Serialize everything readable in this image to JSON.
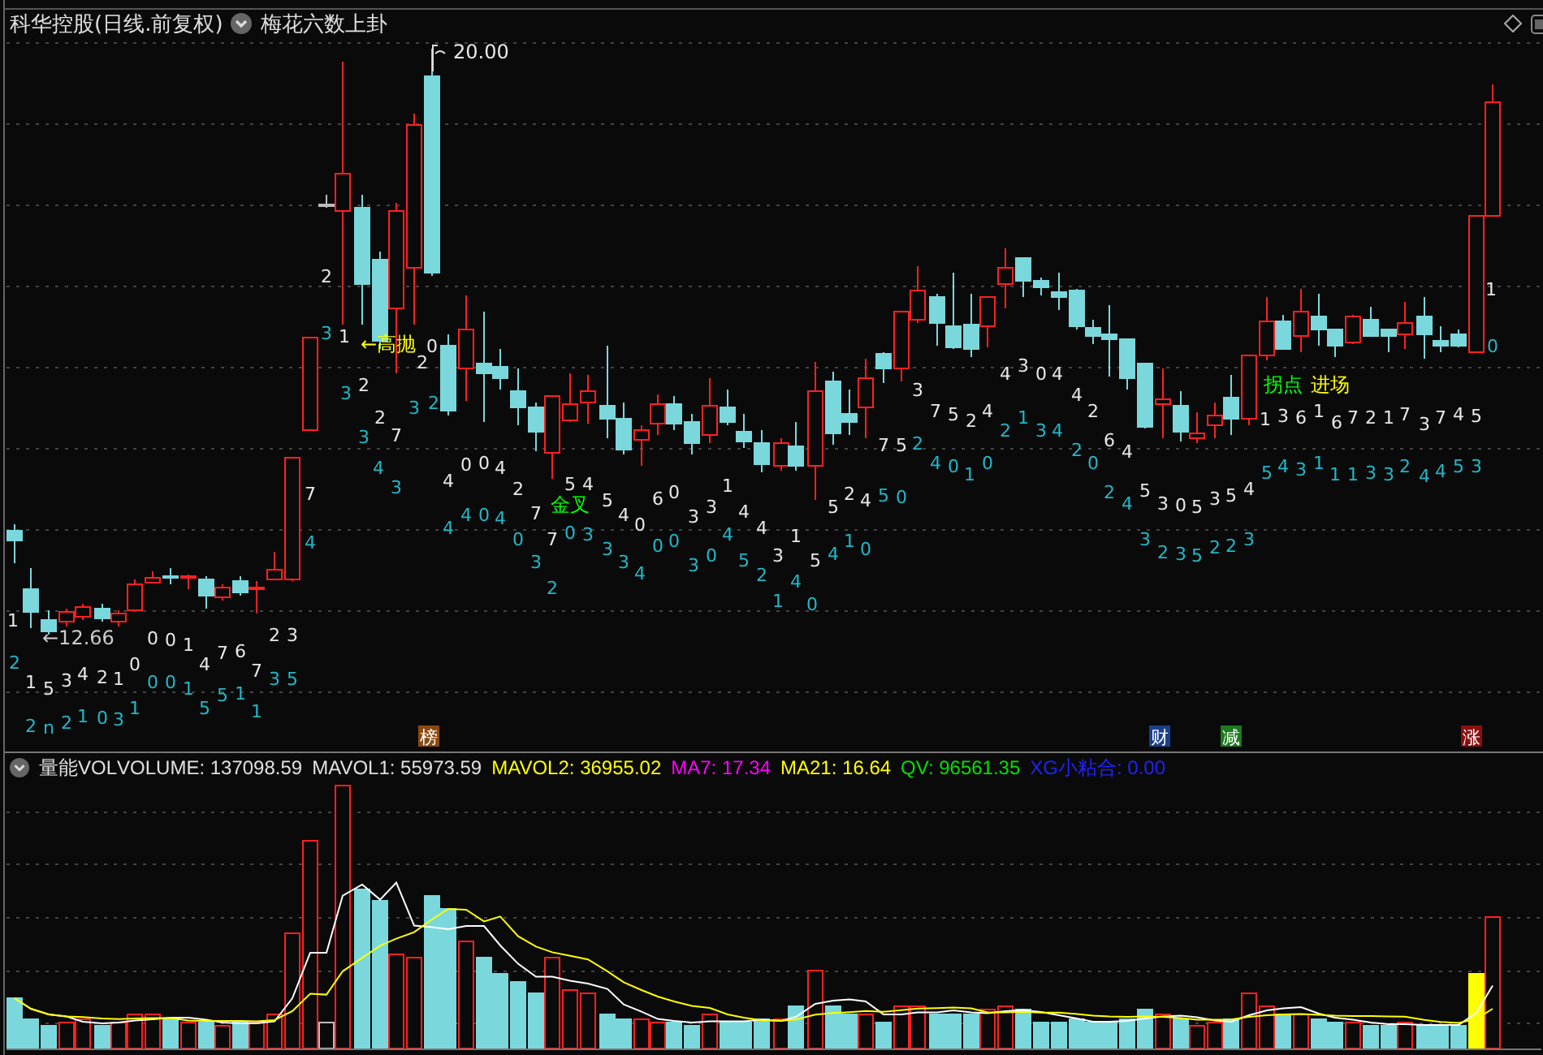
{
  "header": {
    "title": "科华控股(日线.前复权)",
    "indicator": "梅花六数上卦"
  },
  "price_marks": [
    {
      "kind": "high",
      "text": "20.00"
    },
    {
      "kind": "low",
      "text": "←12.66"
    }
  ],
  "signals": [
    {
      "text": "←高抛",
      "color": "#ffff00"
    },
    {
      "text": "金叉",
      "color": "#00ff00"
    },
    {
      "text": "拐点",
      "color": "#00ff00"
    },
    {
      "text": "进场",
      "color": "#ffff00"
    }
  ],
  "digits": [
    {
      "text": "1",
      "color": "#e8e8e8"
    },
    {
      "text": "2",
      "color": "#20b8c8"
    },
    {
      "text": "1",
      "color": "#e8e8e8"
    },
    {
      "text": "5",
      "color": "#e8e8e8"
    },
    {
      "text": "3",
      "color": "#e8e8e8"
    },
    {
      "text": "4",
      "color": "#e8e8e8"
    },
    {
      "text": "2",
      "color": "#e8e8e8"
    },
    {
      "text": "1",
      "color": "#e8e8e8"
    },
    {
      "text": "2",
      "color": "#20b8c8"
    },
    {
      "text": "n",
      "color": "#20b8c8"
    },
    {
      "text": "2",
      "color": "#20b8c8"
    },
    {
      "text": "1",
      "color": "#20b8c8"
    },
    {
      "text": "0",
      "color": "#20b8c8"
    },
    {
      "text": "3",
      "color": "#20b8c8"
    },
    {
      "text": "0",
      "color": "#e8e8e8"
    },
    {
      "text": "1",
      "color": "#20b8c8"
    },
    {
      "text": "0",
      "color": "#e8e8e8"
    },
    {
      "text": "0",
      "color": "#e8e8e8"
    },
    {
      "text": "1",
      "color": "#e8e8e8"
    },
    {
      "text": "0",
      "color": "#20b8c8"
    },
    {
      "text": "0",
      "color": "#20b8c8"
    },
    {
      "text": "1",
      "color": "#20b8c8"
    },
    {
      "text": "4",
      "color": "#e8e8e8"
    },
    {
      "text": "7",
      "color": "#e8e8e8"
    },
    {
      "text": "6",
      "color": "#e8e8e8"
    },
    {
      "text": "7",
      "color": "#e8e8e8"
    },
    {
      "text": "5",
      "color": "#20b8c8"
    },
    {
      "text": "5",
      "color": "#20b8c8"
    },
    {
      "text": "1",
      "color": "#20b8c8"
    },
    {
      "text": "1",
      "color": "#20b8c8"
    },
    {
      "text": "2",
      "color": "#e8e8e8"
    },
    {
      "text": "3",
      "color": "#e8e8e8"
    },
    {
      "text": "3",
      "color": "#20b8c8"
    },
    {
      "text": "5",
      "color": "#20b8c8"
    },
    {
      "text": "7",
      "color": "#e8e8e8"
    },
    {
      "text": "4",
      "color": "#20b8c8"
    },
    {
      "text": "3",
      "color": "#20b8c8"
    },
    {
      "text": "1",
      "color": "#e8e8e8"
    },
    {
      "text": "2",
      "color": "#e8e8e8"
    },
    {
      "text": "3",
      "color": "#20b8c8"
    },
    {
      "text": "2",
      "color": "#e8e8e8"
    },
    {
      "text": "2",
      "color": "#e8e8e8"
    },
    {
      "text": "3",
      "color": "#20b8c8"
    },
    {
      "text": "7",
      "color": "#e8e8e8"
    },
    {
      "text": "4",
      "color": "#20b8c8"
    },
    {
      "text": "3",
      "color": "#20b8c8"
    },
    {
      "text": "2",
      "color": "#e8e8e8"
    },
    {
      "text": "0",
      "color": "#e8e8e8"
    },
    {
      "text": "3",
      "color": "#20b8c8"
    },
    {
      "text": "2",
      "color": "#20b8c8"
    },
    {
      "text": "4",
      "color": "#e8e8e8"
    },
    {
      "text": "0",
      "color": "#e8e8e8"
    },
    {
      "text": "0",
      "color": "#e8e8e8"
    },
    {
      "text": "4",
      "color": "#e8e8e8"
    },
    {
      "text": "2",
      "color": "#e8e8e8"
    },
    {
      "text": "7",
      "color": "#e8e8e8"
    },
    {
      "text": "5",
      "color": "#e8e8e8"
    },
    {
      "text": "4",
      "color": "#e8e8e8"
    },
    {
      "text": "4",
      "color": "#20b8c8"
    },
    {
      "text": "4",
      "color": "#20b8c8"
    },
    {
      "text": "0",
      "color": "#20b8c8"
    },
    {
      "text": "4",
      "color": "#20b8c8"
    },
    {
      "text": "0",
      "color": "#20b8c8"
    },
    {
      "text": "3",
      "color": "#20b8c8"
    },
    {
      "text": "2",
      "color": "#20b8c8"
    },
    {
      "text": "7",
      "color": "#e8e8e8"
    },
    {
      "text": "0",
      "color": "#20b8c8"
    },
    {
      "text": "3",
      "color": "#20b8c8"
    },
    {
      "text": "5",
      "color": "#e8e8e8"
    },
    {
      "text": "4",
      "color": "#e8e8e8"
    },
    {
      "text": "0",
      "color": "#e8e8e8"
    },
    {
      "text": "6",
      "color": "#e8e8e8"
    },
    {
      "text": "0",
      "color": "#e8e8e8"
    },
    {
      "text": "3",
      "color": "#20b8c8"
    },
    {
      "text": "3",
      "color": "#20b8c8"
    },
    {
      "text": "4",
      "color": "#20b8c8"
    },
    {
      "text": "0",
      "color": "#20b8c8"
    },
    {
      "text": "0",
      "color": "#20b8c8"
    },
    {
      "text": "3",
      "color": "#e8e8e8"
    },
    {
      "text": "3",
      "color": "#e8e8e8"
    },
    {
      "text": "1",
      "color": "#e8e8e8"
    },
    {
      "text": "4",
      "color": "#e8e8e8"
    },
    {
      "text": "4",
      "color": "#e8e8e8"
    },
    {
      "text": "3",
      "color": "#20b8c8"
    },
    {
      "text": "0",
      "color": "#20b8c8"
    },
    {
      "text": "4",
      "color": "#20b8c8"
    },
    {
      "text": "5",
      "color": "#20b8c8"
    },
    {
      "text": "2",
      "color": "#20b8c8"
    },
    {
      "text": "1",
      "color": "#20b8c8"
    },
    {
      "text": "3",
      "color": "#e8e8e8"
    },
    {
      "text": "1",
      "color": "#e8e8e8"
    },
    {
      "text": "4",
      "color": "#20b8c8"
    },
    {
      "text": "0",
      "color": "#20b8c8"
    },
    {
      "text": "5",
      "color": "#e8e8e8"
    },
    {
      "text": "4",
      "color": "#20b8c8"
    },
    {
      "text": "1",
      "color": "#20b8c8"
    },
    {
      "text": "0",
      "color": "#20b8c8"
    },
    {
      "text": "5",
      "color": "#e8e8e8"
    },
    {
      "text": "2",
      "color": "#e8e8e8"
    },
    {
      "text": "4",
      "color": "#e8e8e8"
    },
    {
      "text": "5",
      "color": "#20b8c8"
    },
    {
      "text": "0",
      "color": "#20b8c8"
    },
    {
      "text": "7",
      "color": "#e8e8e8"
    },
    {
      "text": "5",
      "color": "#e8e8e8"
    },
    {
      "text": "2",
      "color": "#20b8c8"
    },
    {
      "text": "3",
      "color": "#e8e8e8"
    },
    {
      "text": "7",
      "color": "#e8e8e8"
    },
    {
      "text": "5",
      "color": "#e8e8e8"
    },
    {
      "text": "2",
      "color": "#e8e8e8"
    },
    {
      "text": "4",
      "color": "#e8e8e8"
    },
    {
      "text": "4",
      "color": "#20b8c8"
    },
    {
      "text": "0",
      "color": "#20b8c8"
    },
    {
      "text": "1",
      "color": "#20b8c8"
    },
    {
      "text": "0",
      "color": "#20b8c8"
    },
    {
      "text": "4",
      "color": "#e8e8e8"
    },
    {
      "text": "3",
      "color": "#e8e8e8"
    },
    {
      "text": "0",
      "color": "#e8e8e8"
    },
    {
      "text": "4",
      "color": "#e8e8e8"
    },
    {
      "text": "2",
      "color": "#20b8c8"
    },
    {
      "text": "1",
      "color": "#20b8c8"
    },
    {
      "text": "3",
      "color": "#20b8c8"
    },
    {
      "text": "4",
      "color": "#20b8c8"
    },
    {
      "text": "4",
      "color": "#e8e8e8"
    },
    {
      "text": "2",
      "color": "#e8e8e8"
    },
    {
      "text": "2",
      "color": "#20b8c8"
    },
    {
      "text": "0",
      "color": "#20b8c8"
    },
    {
      "text": "6",
      "color": "#e8e8e8"
    },
    {
      "text": "4",
      "color": "#e8e8e8"
    },
    {
      "text": "2",
      "color": "#20b8c8"
    },
    {
      "text": "4",
      "color": "#20b8c8"
    },
    {
      "text": "5",
      "color": "#e8e8e8"
    },
    {
      "text": "3",
      "color": "#e8e8e8"
    },
    {
      "text": "0",
      "color": "#e8e8e8"
    },
    {
      "text": "5",
      "color": "#e8e8e8"
    },
    {
      "text": "3",
      "color": "#e8e8e8"
    },
    {
      "text": "5",
      "color": "#e8e8e8"
    },
    {
      "text": "4",
      "color": "#e8e8e8"
    },
    {
      "text": "3",
      "color": "#20b8c8"
    },
    {
      "text": "2",
      "color": "#20b8c8"
    },
    {
      "text": "3",
      "color": "#20b8c8"
    },
    {
      "text": "5",
      "color": "#20b8c8"
    },
    {
      "text": "2",
      "color": "#20b8c8"
    },
    {
      "text": "2",
      "color": "#20b8c8"
    },
    {
      "text": "3",
      "color": "#20b8c8"
    },
    {
      "text": "1",
      "color": "#e8e8e8"
    },
    {
      "text": "3",
      "color": "#e8e8e8"
    },
    {
      "text": "6",
      "color": "#e8e8e8"
    },
    {
      "text": "1",
      "color": "#e8e8e8"
    },
    {
      "text": "6",
      "color": "#e8e8e8"
    },
    {
      "text": "7",
      "color": "#e8e8e8"
    },
    {
      "text": "2",
      "color": "#e8e8e8"
    },
    {
      "text": "1",
      "color": "#e8e8e8"
    },
    {
      "text": "7",
      "color": "#e8e8e8"
    },
    {
      "text": "3",
      "color": "#e8e8e8"
    },
    {
      "text": "7",
      "color": "#e8e8e8"
    },
    {
      "text": "4",
      "color": "#e8e8e8"
    },
    {
      "text": "5",
      "color": "#e8e8e8"
    },
    {
      "text": "5",
      "color": "#20b8c8"
    },
    {
      "text": "4",
      "color": "#20b8c8"
    },
    {
      "text": "3",
      "color": "#20b8c8"
    },
    {
      "text": "1",
      "color": "#20b8c8"
    },
    {
      "text": "1",
      "color": "#20b8c8"
    },
    {
      "text": "1",
      "color": "#20b8c8"
    },
    {
      "text": "3",
      "color": "#20b8c8"
    },
    {
      "text": "3",
      "color": "#20b8c8"
    },
    {
      "text": "2",
      "color": "#20b8c8"
    },
    {
      "text": "4",
      "color": "#20b8c8"
    },
    {
      "text": "4",
      "color": "#20b8c8"
    },
    {
      "text": "5",
      "color": "#20b8c8"
    },
    {
      "text": "3",
      "color": "#20b8c8"
    },
    {
      "text": "1",
      "color": "#e8e8e8"
    },
    {
      "text": "0",
      "color": "#20b8c8"
    }
  ],
  "event_badges": [
    {
      "text": "榜",
      "color": "#8b4a12"
    },
    {
      "text": "财",
      "color": "#1c3f8a"
    },
    {
      "text": "减",
      "color": "#1e7a1e"
    },
    {
      "text": "涨",
      "color": "#8a1010"
    }
  ],
  "volume_legend": [
    {
      "text": "量能VOL",
      "color": "#e0e0e0"
    },
    {
      "text": "VOLUME: 137098.59",
      "color": "#e0e0e0"
    },
    {
      "text": "MAVOL1: 55973.59",
      "color": "#e0e0e0"
    },
    {
      "text": "MAVOL2: 36955.02",
      "color": "#ffff00"
    },
    {
      "text": "MA7: 17.34",
      "color": "#ff00ff"
    },
    {
      "text": "MA21: 16.64",
      "color": "#ffff00"
    },
    {
      "text": "QV: 96561.35",
      "color": "#00e000"
    },
    {
      "text": "XG小粘合: 0.00",
      "color": "#2222ff"
    }
  ]
}
